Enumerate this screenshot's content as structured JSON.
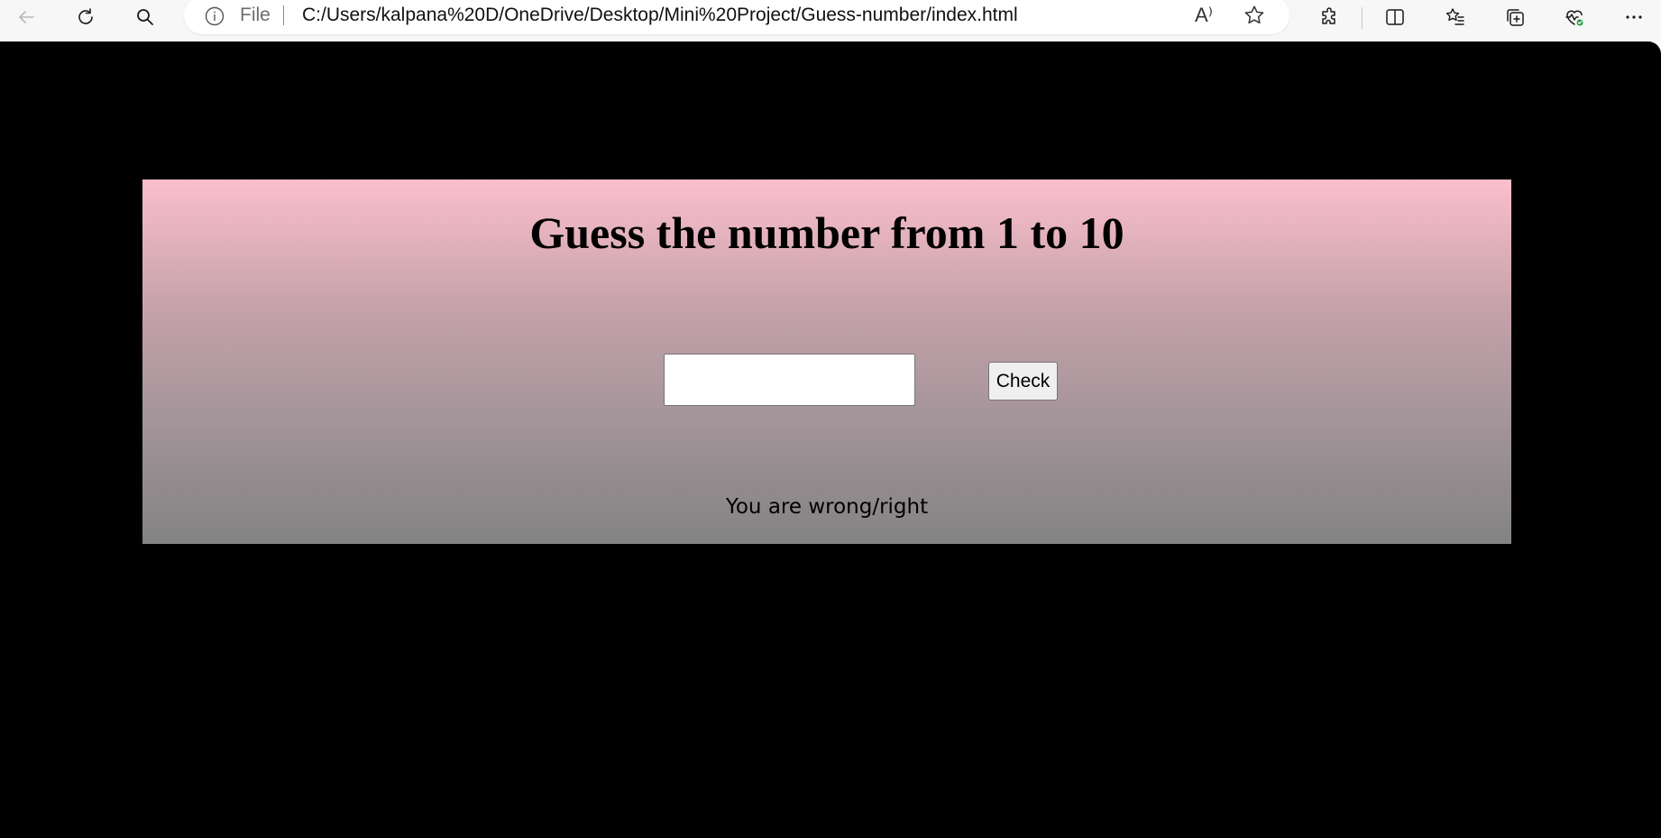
{
  "browser": {
    "address_bar": {
      "scheme_label": "File",
      "url": "C:/Users/kalpana%20D/OneDrive/Desktop/Mini%20Project/Guess-number/index.html",
      "read_aloud_glyph": "A⁾"
    },
    "toolbar_icons": [
      "back-icon",
      "refresh-icon",
      "search-icon",
      "info-icon",
      "read-aloud-icon",
      "favorite-star-icon",
      "extensions-icon",
      "split-screen-icon",
      "favorites-icon",
      "collections-icon",
      "browser-essentials-icon",
      "more-icon"
    ]
  },
  "page": {
    "title": "Guess the number from 1 to 10",
    "guess_input": {
      "value": "",
      "placeholder": ""
    },
    "check_button_label": "Check",
    "result_text": "You are wrong/right"
  },
  "colors": {
    "page_background": "#000000",
    "panel_gradient_top": "#fbbfcb",
    "panel_gradient_bottom": "#838383"
  }
}
